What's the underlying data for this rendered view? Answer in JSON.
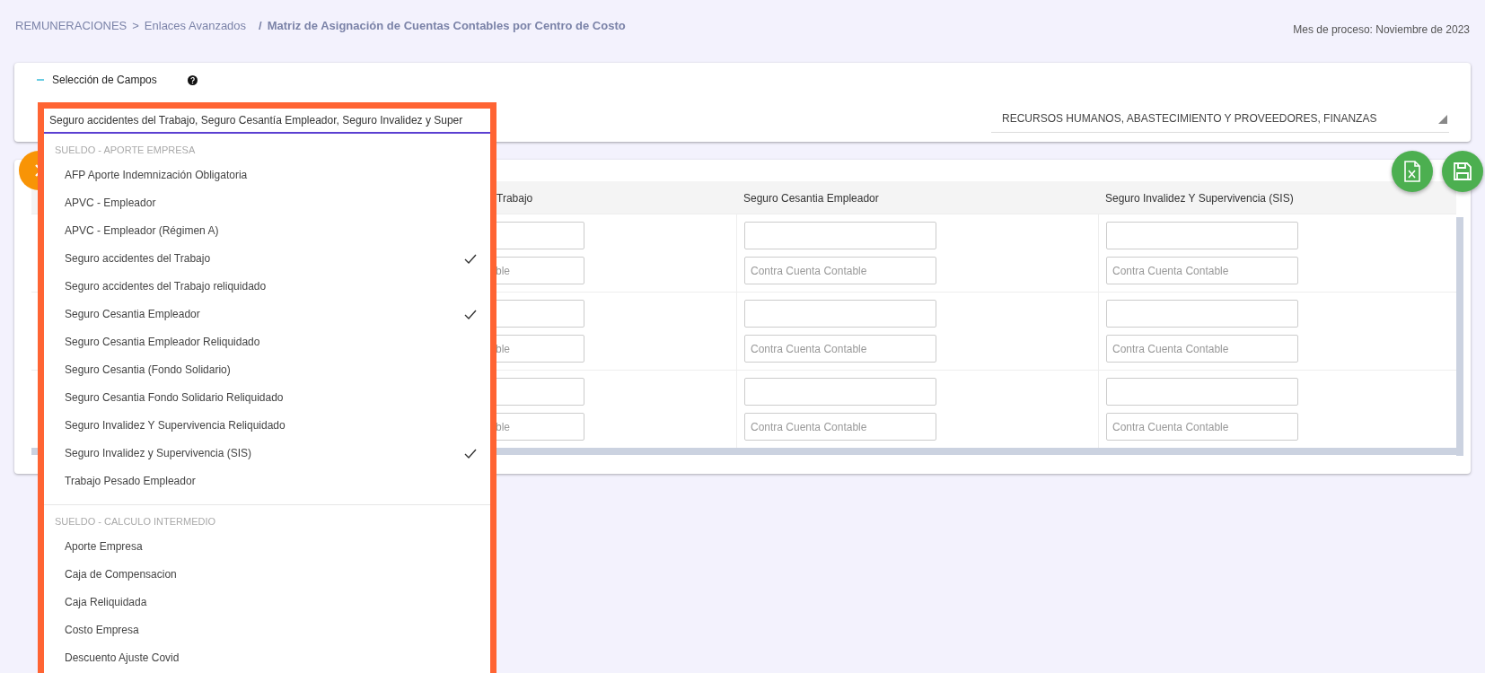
{
  "breadcrumb": {
    "items": [
      "REMUNERACIONES",
      "Enlaces Avanzados"
    ],
    "separator": ">",
    "current_separator": "/",
    "current": "Matriz de Asignación de Cuentas Contables por Centro de Costo"
  },
  "process_month": "Mes de proceso: Noviembre de 2023",
  "filters": {
    "section": {
      "title": "Selección de Campos",
      "expanded": true
    },
    "fields_select": {
      "value": "Seguro accidentes del Trabajo, Seguro Cesantía Empleador, Seguro Invalidez y Super",
      "open": true
    },
    "area_select": {
      "value": "RECURSOS HUMANOS, ABASTECIMIENTO Y PROVEEDORES, FINANZAS"
    }
  },
  "field_dropdown": {
    "groups": [
      {
        "label": "SUELDO - APORTE EMPRESA",
        "options": [
          {
            "label": "AFP Aporte Indemnización Obligatoria",
            "checked": false
          },
          {
            "label": "APVC - Empleador",
            "checked": false
          },
          {
            "label": "APVC - Empleador (Régimen A)",
            "checked": false
          },
          {
            "label": "Seguro accidentes del Trabajo",
            "checked": true
          },
          {
            "label": "Seguro accidentes del Trabajo reliquidado",
            "checked": false
          },
          {
            "label": "Seguro Cesantia Empleador",
            "checked": true
          },
          {
            "label": "Seguro Cesantia Empleador Reliquidado",
            "checked": false
          },
          {
            "label": "Seguro Cesantia (Fondo Solidario)",
            "checked": false
          },
          {
            "label": "Seguro Cesantia Fondo Solidario Reliquidado",
            "checked": false
          },
          {
            "label": "Seguro Invalidez Y Supervivencia Reliquidado",
            "checked": false
          },
          {
            "label": "Seguro Invalidez y Supervivencia (SIS)",
            "checked": true
          },
          {
            "label": "Trabajo Pesado Empleador",
            "checked": false
          }
        ]
      },
      {
        "label": "SUELDO - CALCULO INTERMEDIO",
        "options": [
          {
            "label": "Aporte Empresa",
            "checked": false
          },
          {
            "label": "Caja de Compensacion",
            "checked": false
          },
          {
            "label": "Caja Reliquidada",
            "checked": false
          },
          {
            "label": "Costo Empresa",
            "checked": false
          },
          {
            "label": "Descuento Ajuste Covid",
            "checked": false
          }
        ]
      }
    ]
  },
  "table": {
    "columns": [
      "Trabajo",
      "Seguro Cesantia Empleador",
      "Seguro Invalidez Y Supervivencia (SIS)"
    ],
    "rows": [
      {
        "counter_placeholders": [
          "ble",
          "Contra Cuenta Contable",
          "Contra Cuenta Contable"
        ]
      },
      {
        "counter_placeholders": [
          "ble",
          "Contra Cuenta Contable",
          "Contra Cuenta Contable"
        ]
      },
      {
        "counter_placeholders": [
          "ble",
          "Contra Cuenta Contable",
          "Contra Cuenta Contable"
        ]
      }
    ]
  }
}
